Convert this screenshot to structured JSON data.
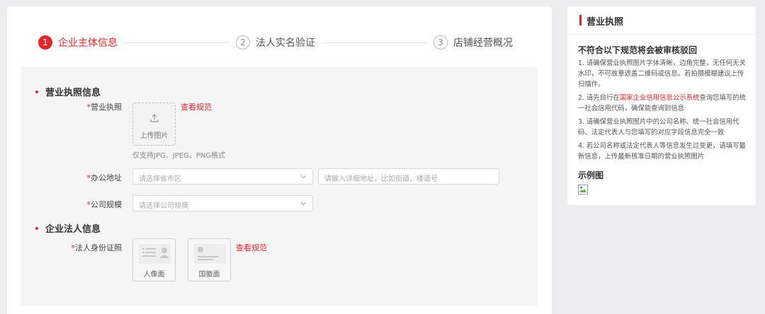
{
  "steps": [
    {
      "num": "1",
      "label": "企业主体信息",
      "state": "active"
    },
    {
      "num": "2",
      "label": "法人实名验证",
      "state": "idle"
    },
    {
      "num": "3",
      "label": "店铺经营概况",
      "state": "idle"
    }
  ],
  "form": {
    "license_section": {
      "title": "营业执照信息",
      "license_field": {
        "label_req": "*",
        "label": "营业执照",
        "upload_icon": "upload-icon",
        "upload_text": "上传图片",
        "spec_link": "查看规范",
        "hint": "仅支持JPG、JPEG、PNG格式"
      },
      "address_field": {
        "label_req": "*",
        "label": "办公地址",
        "region_placeholder": "请选择省市区",
        "detail_placeholder": "请输入详细地址，比如街道，楼道号"
      },
      "scale_field": {
        "label_req": "*",
        "label": "公司规模",
        "placeholder": "请选择公司规模"
      }
    },
    "legal_section": {
      "title": "企业法人信息",
      "id_field": {
        "label_req": "*",
        "label": "法人身份证照",
        "front_text": "人像面",
        "back_text": "国徽面",
        "spec_link": "查看规范"
      }
    }
  },
  "sidebar": {
    "title": "营业执照",
    "subtitle": "不符合以下规范将会被审核驳回",
    "rules": {
      "r1": "1. 请确保营业执照图片字体清晰，边角完整，无任何无关水印，不可故意遮盖二维码或信息。若拍摄模糊建议上传扫描件。",
      "r2_pre": "2. 请先自行在",
      "r2_link": "国家企业信用信息公示系统",
      "r2_post": "查询您填写的统一社会信用代码，确保能查询到信息",
      "r3": "3. 请确保营业执照图片中的公司名称、统一社会信用代码、法定代表人与您填写的对应字段信息完全一致",
      "r4": "4. 若公司名称或法定代表人等信息发生过变更，请填写最新信息，上传最新核准日期的营业执照图片"
    },
    "example_title": "示例图",
    "example_icon": "broken-image-icon"
  },
  "colors": {
    "accent": "#e4262b",
    "page_bg": "#ededf0",
    "panel_bg": "#f5f5f5"
  }
}
